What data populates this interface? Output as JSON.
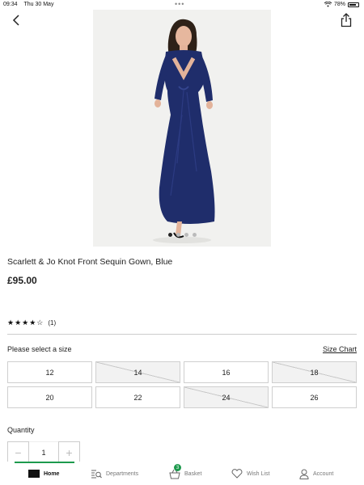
{
  "status": {
    "time": "09:34",
    "date": "Thu 30 May",
    "battery": "78%",
    "battery_level": 0.78
  },
  "nav": {
    "back_icon": "chevron-left-icon",
    "share_icon": "share-icon"
  },
  "product": {
    "title": "Scarlett & Jo Knot Front Sequin Gown, Blue",
    "price": "£95.00",
    "image_count": 4,
    "image_active_index": 0,
    "rating_stars": "★★★★☆",
    "rating_value": 4,
    "rating_count": "(1)"
  },
  "size": {
    "label": "Please select a size",
    "chart_link": "Size Chart",
    "options": [
      {
        "label": "12",
        "available": true
      },
      {
        "label": "14",
        "available": false
      },
      {
        "label": "16",
        "available": true
      },
      {
        "label": "18",
        "available": false
      },
      {
        "label": "20",
        "available": true
      },
      {
        "label": "22",
        "available": true
      },
      {
        "label": "24",
        "available": false
      },
      {
        "label": "26",
        "available": true
      }
    ]
  },
  "quantity": {
    "label": "Quantity",
    "value": "1",
    "minus": "−",
    "plus": "+"
  },
  "tabs": [
    {
      "label": "Home",
      "icon": "home-icon",
      "active": true
    },
    {
      "label": "Departments",
      "icon": "departments-search-icon",
      "active": false
    },
    {
      "label": "Basket",
      "icon": "basket-icon",
      "active": false,
      "badge": "3"
    },
    {
      "label": "Wish List",
      "icon": "heart-icon",
      "active": false
    },
    {
      "label": "Account",
      "icon": "account-icon",
      "active": false
    }
  ],
  "colors": {
    "accent": "#1d9a4d",
    "text": "#222222",
    "dress": "#1f2d6b"
  }
}
